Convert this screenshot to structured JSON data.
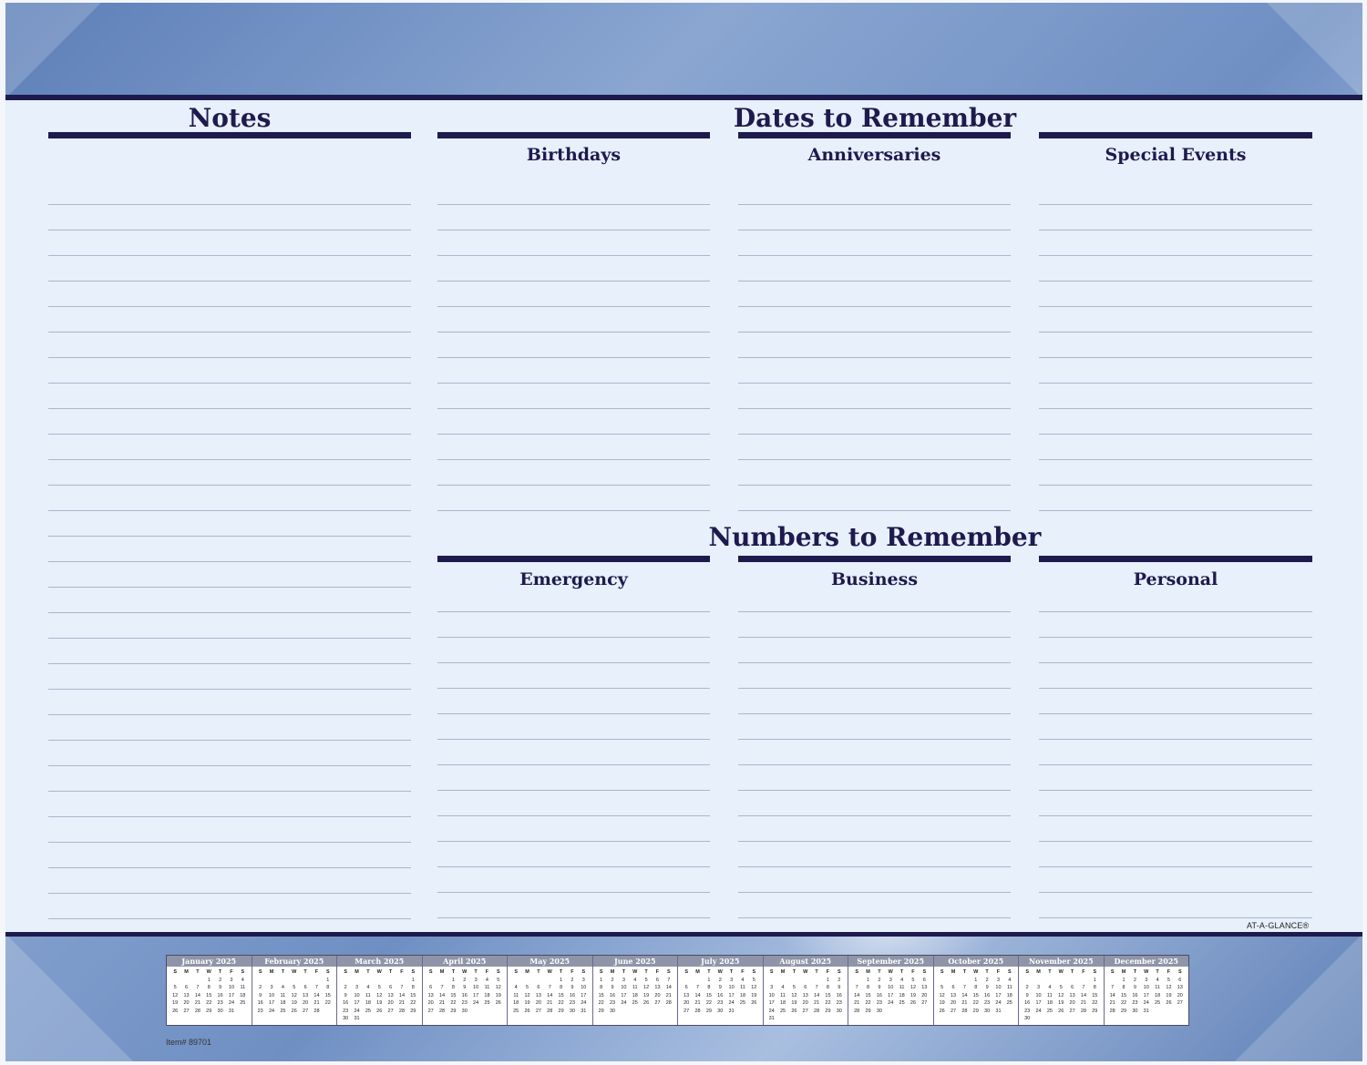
{
  "sections": {
    "notes_title": "Notes",
    "dates_title": "Dates to Remember",
    "numbers_title": "Numbers to Remember"
  },
  "columns": {
    "birthdays": "Birthdays",
    "anniversaries": "Anniversaries",
    "special_events": "Special Events",
    "emergency": "Emergency",
    "business": "Business",
    "personal": "Personal"
  },
  "brand": "AT-A-GLANCE®",
  "item_number": "Item# 89701",
  "weekday_letters": [
    "S",
    "M",
    "T",
    "W",
    "T",
    "F",
    "S"
  ],
  "year_calendar": [
    {
      "name": "January 2025",
      "start": 3,
      "days": 31
    },
    {
      "name": "February 2025",
      "start": 6,
      "days": 28
    },
    {
      "name": "March 2025",
      "start": 6,
      "days": 31
    },
    {
      "name": "April 2025",
      "start": 2,
      "days": 30
    },
    {
      "name": "May 2025",
      "start": 4,
      "days": 31
    },
    {
      "name": "June 2025",
      "start": 0,
      "days": 30
    },
    {
      "name": "July 2025",
      "start": 2,
      "days": 31
    },
    {
      "name": "August 2025",
      "start": 5,
      "days": 31
    },
    {
      "name": "September 2025",
      "start": 1,
      "days": 30
    },
    {
      "name": "October 2025",
      "start": 3,
      "days": 31
    },
    {
      "name": "November 2025",
      "start": 6,
      "days": 30
    },
    {
      "name": "December 2025",
      "start": 1,
      "days": 31
    }
  ]
}
